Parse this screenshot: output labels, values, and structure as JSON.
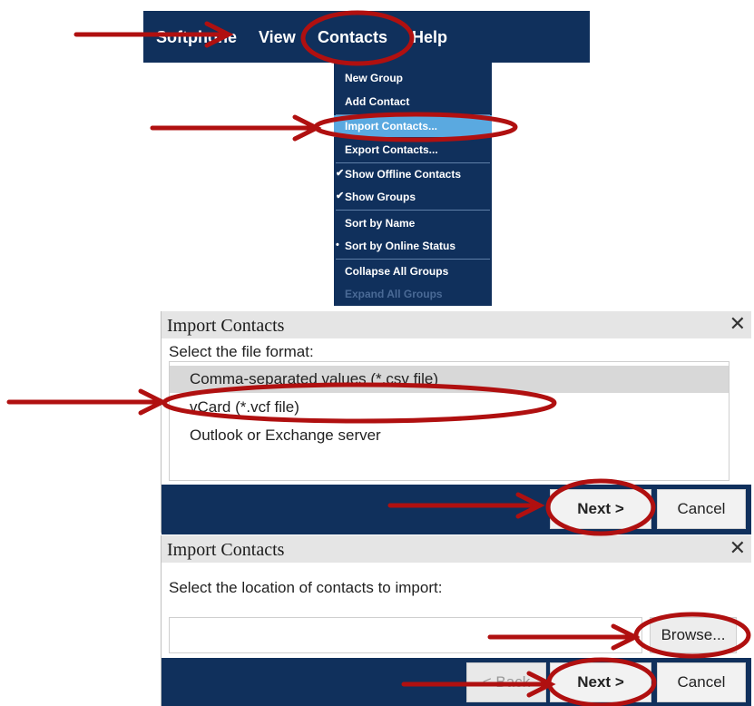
{
  "menubar": {
    "items": [
      "Softphone",
      "View",
      "Contacts",
      "Help"
    ]
  },
  "contacts_menu": {
    "items": [
      {
        "label": "New Group",
        "mark": ""
      },
      {
        "label": "Add Contact",
        "mark": ""
      },
      {
        "label": "Import Contacts...",
        "mark": ""
      },
      {
        "label": "Export Contacts...",
        "mark": ""
      },
      {
        "label": "Show Offline Contacts",
        "mark": "✔"
      },
      {
        "label": "Show Groups",
        "mark": "✔"
      },
      {
        "label": "Sort by Name",
        "mark": ""
      },
      {
        "label": "Sort by Online Status",
        "mark": "•"
      },
      {
        "label": "Collapse All Groups",
        "mark": ""
      },
      {
        "label": "Expand All Groups",
        "mark": ""
      }
    ]
  },
  "dialog_format": {
    "title": "Import Contacts",
    "close_glyph": "✕",
    "prompt": "Select the file format:",
    "options": [
      "Comma-separated values (*.csv file)",
      "vCard (*.vcf file)",
      "Outlook or Exchange server"
    ],
    "next_label": "Next >",
    "cancel_label": "Cancel"
  },
  "dialog_location": {
    "title": "Import Contacts",
    "close_glyph": "✕",
    "prompt": "Select the location of contacts to import:",
    "path_value": "",
    "browse_label": "Browse...",
    "back_label": "< Back",
    "next_label": "Next >",
    "cancel_label": "Cancel"
  },
  "colors": {
    "navy": "#10305c",
    "highlight": "#5aa9e0",
    "annotation_red": "#b01010"
  }
}
